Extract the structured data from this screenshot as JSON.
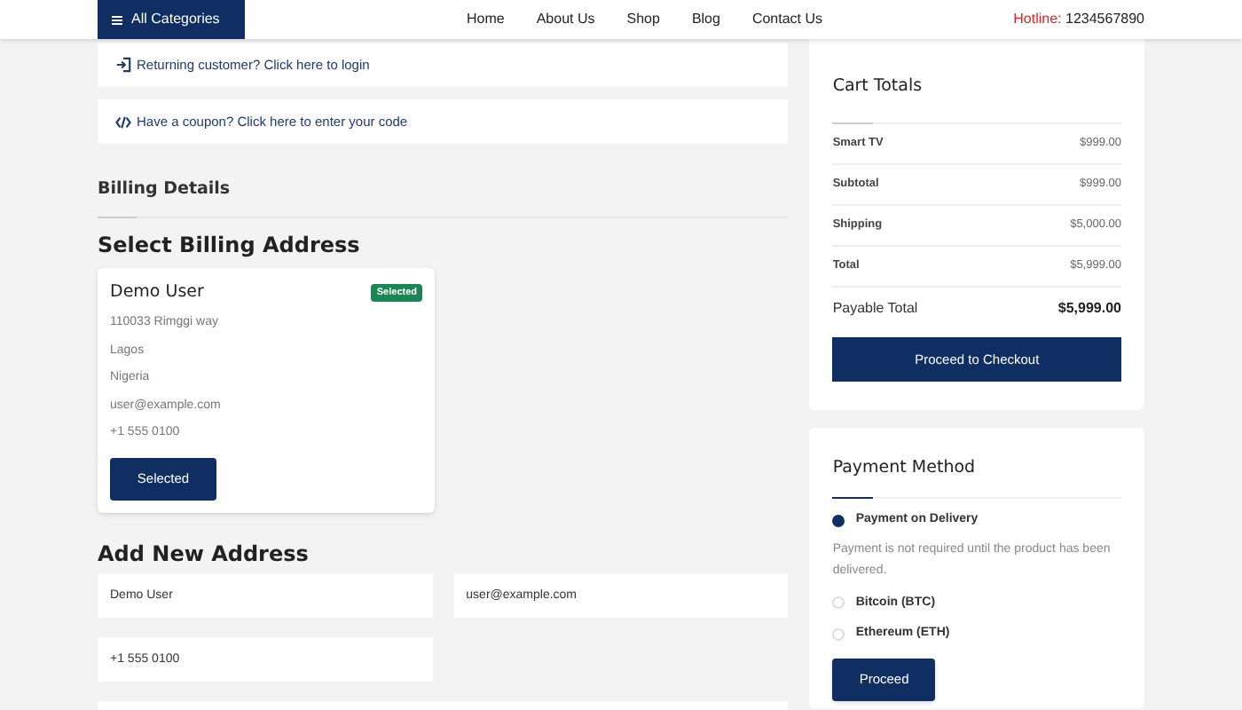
{
  "header": {
    "categories_button": "All Categories",
    "nav": [
      "Home",
      "About Us",
      "Shop",
      "Blog",
      "Contact Us"
    ],
    "hotline_label": "Hotline:",
    "hotline_number": "1234567890"
  },
  "notices": [
    {
      "kind": "login",
      "text": "Returning customer? Click here to login"
    },
    {
      "kind": "coupon",
      "text": "Have a coupon? Click here to enter your code"
    }
  ],
  "billing": {
    "title": "Billing Details",
    "select_title": "Select Billing Address",
    "addresses": [
      {
        "name": "Demo User",
        "badge": "Selected",
        "lines": [
          "110033 Rimggi way",
          "Lagos",
          "Nigeria",
          "user@example.com",
          "+1 555 0100"
        ],
        "button": "Selected",
        "selected": true
      }
    ],
    "new_title": "Add New Address",
    "fields": [
      {
        "value": "Demo User"
      },
      {
        "value": "user@example.com"
      },
      {
        "value": "+1 555 0100"
      }
    ]
  },
  "cart": {
    "title": "Cart Totals",
    "rows": [
      {
        "label": "Smart TV",
        "value": "$999.00",
        "strong": false
      },
      {
        "label": "Subtotal",
        "value": "$999.00",
        "strong": false
      },
      {
        "label": "Shipping",
        "value": "$5,000.00",
        "strong": false
      },
      {
        "label": "Total",
        "value": "$5,999.00",
        "strong": false
      },
      {
        "label": "Payable Total",
        "value": "$5,999.00",
        "strong": true
      }
    ],
    "button": "Proceed to Checkout"
  },
  "payment": {
    "title": "Payment Method",
    "options": [
      {
        "label": "Payment on Delivery",
        "selected": true,
        "note": "Payment is not required until the product has been delivered."
      },
      {
        "label": "Bitcoin (BTC)",
        "selected": false
      },
      {
        "label": "Ethereum (ETH)",
        "selected": false
      }
    ],
    "button": "Proceed"
  }
}
